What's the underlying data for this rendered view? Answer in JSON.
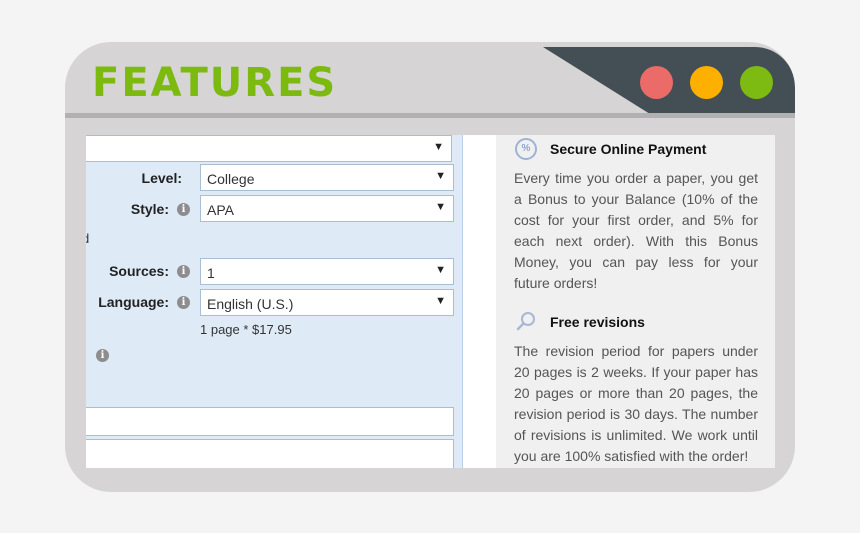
{
  "window": {
    "title": "FEATURES",
    "controls": [
      {
        "name": "close",
        "color": "#ea6b68"
      },
      {
        "name": "minimize",
        "color": "#feb000"
      },
      {
        "name": "maximize",
        "color": "#7dbb13"
      }
    ]
  },
  "form": {
    "top_select_value": "",
    "level": {
      "label": "Level:",
      "value": "College"
    },
    "style": {
      "label": "Style:",
      "value": "APA"
    },
    "partial_label": "d",
    "sources": {
      "label": "Sources:",
      "value": "1"
    },
    "language": {
      "label": "Language:",
      "value": "English (U.S.)"
    },
    "price_text": "1 page * $17.95",
    "dropdown_arrow": "▼",
    "info_glyph": "i"
  },
  "features": [
    {
      "icon": "percent-icon",
      "icon_glyph": "%",
      "title": "Secure Online Payment",
      "body": "Every time you order a paper, you get a Bonus to your Balance (10% of the cost for your first order, and 5% for each next order). With this Bonus Money, you can pay less for your future orders!"
    },
    {
      "icon": "search-icon",
      "title": "Free revisions",
      "body": "The revision period for papers under 20 pages is 2 weeks. If your paper has 20 pages or more than 20 pages, the revision period is 30 days. The number of revisions is unlimited. We work until you are 100% satisfied with the order!"
    }
  ]
}
